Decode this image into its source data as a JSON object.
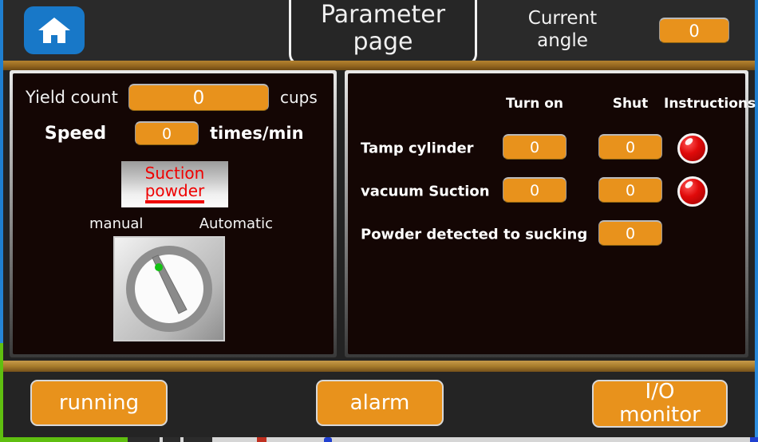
{
  "header": {
    "home_icon": "home-icon",
    "title_line1": "Parameter",
    "title_line2": "page",
    "angle_label_line1": "Current",
    "angle_label_line2": "angle",
    "angle_value": "0"
  },
  "left_panel": {
    "yield": {
      "label": "Yield count",
      "value": "0",
      "unit": "cups"
    },
    "speed": {
      "label": "Speed",
      "value": "0",
      "unit": "times/min"
    },
    "suction_button": {
      "line1": "Suction",
      "line2": "powder"
    },
    "mode": {
      "manual": "manual",
      "automatic": "Automatic"
    },
    "selector": {
      "name": "rotary-selector-switch",
      "led": "green"
    }
  },
  "right_panel": {
    "columns": [
      "Turn on",
      "Shut",
      "Instructions"
    ],
    "rows": [
      {
        "label": "Tamp cylinder",
        "turn_on": "0",
        "shut": "0",
        "indicator": "red"
      },
      {
        "label": "vacuum Suction",
        "turn_on": "0",
        "shut": "0",
        "indicator": "red"
      },
      {
        "label": "Powder detected to sucking",
        "turn_on": null,
        "shut": "0",
        "indicator": null
      }
    ]
  },
  "footer": {
    "running": "running",
    "alarm": "alarm",
    "io_monitor_line1": "I/O",
    "io_monitor_line2": "monitor"
  },
  "colors": {
    "accent_orange": "#e8921c",
    "home_blue": "#1878c8",
    "alarm_red": "#ef0000",
    "panel_bg": "#140604",
    "chrome": "#2a2a2a",
    "bronze_band": "#a87c2c"
  }
}
